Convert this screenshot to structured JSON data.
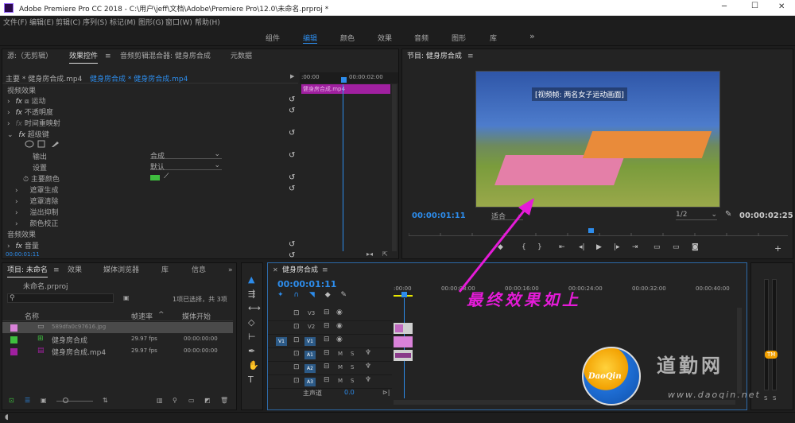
{
  "titlebar": {
    "title": "Adobe Premiere Pro CC 2018 - C:\\用户\\jeff\\文档\\Adobe\\Premiere Pro\\12.0\\未命名.prproj *",
    "min": "─",
    "max": "☐",
    "close": "✕"
  },
  "menu": [
    "文件(F)",
    "编辑(E)",
    "剪辑(C)",
    "序列(S)",
    "标记(M)",
    "图形(G)",
    "窗口(W)",
    "帮助(H)"
  ],
  "workspaces": [
    "组件",
    "编辑",
    "颜色",
    "效果",
    "音频",
    "图形",
    "库"
  ],
  "workspace_more": "»",
  "source_panel": {
    "tabs": [
      "源:（无剪辑）",
      "效果控件",
      "音频剪辑混合器: 健身房合成",
      "元数据"
    ],
    "tab_menu": "≡",
    "master": "主要 * 健身房合成.mp4",
    "clip": "健身房合成 * 健身房合成.mp4",
    "play": "▶",
    "ruler_start": ":00:00",
    "ruler_end": "00:00:02:00",
    "clip_label": "健身房合成.mp4",
    "section_video": "视频效果",
    "section_audio": "音频效果",
    "fx": "fx",
    "effects": [
      "运动",
      "不透明度",
      "时间重映射",
      "超级键"
    ],
    "props": [
      {
        "label": "输出",
        "value": "合成"
      },
      {
        "label": "设置",
        "value": "默认"
      },
      {
        "label": "主要颜色",
        "color": "#3fbf3f"
      }
    ],
    "sub": [
      "遮罩生成",
      "遮罩清除",
      "溢出抑制",
      "颜色校正"
    ],
    "audio_effect": "音量",
    "timecode": "00:00:01:11"
  },
  "program": {
    "title": "节目: 健身房合成",
    "tab_menu": "≡",
    "video_alt": "[视频帧: 两名女子运动画面]",
    "timecode": "00:00:01:11",
    "fit": "适合",
    "res": "1/2",
    "duration": "00:00:02:25"
  },
  "project": {
    "tabs": [
      "项目: 未命名",
      "效果",
      "媒体浏览器",
      "库",
      "信息"
    ],
    "tab_menu": "≡",
    "more": "»",
    "name": "未命名.prproj",
    "selection": "1项已选择，共 3项",
    "columns": [
      "名称",
      "帧速率",
      "媒体开始"
    ],
    "sort": "^",
    "items": [
      {
        "name": "589dfa0c97616.jpg",
        "rate": "",
        "start": "",
        "color": "#d982d9",
        "selected": true
      },
      {
        "name": "健身房合成",
        "rate": "29.97 fps",
        "start": "00:00:00:00",
        "color": "#3fbf3f",
        "selected": false
      },
      {
        "name": "健身房合成.mp4",
        "rate": "29.97 fps",
        "start": "00:00:00:00",
        "color": "#a020a0",
        "selected": false
      }
    ]
  },
  "timeline": {
    "title": "健身房合成",
    "tab_menu": "≡",
    "close": "✕",
    "timecode": "00:00:01:11",
    "ruler": [
      ":00:00",
      "00:00:08:00",
      "00:00:16:00",
      "00:00:24:00",
      "00:00:32:00",
      "00:00:40:00"
    ],
    "tracks": [
      "V3",
      "V2",
      "V1",
      "A1",
      "A2",
      "A3"
    ],
    "source_patch": "V1",
    "master": "主声道",
    "master_value": "0.0",
    "ms": [
      "M",
      "S"
    ],
    "annotation": "最终效果如上"
  },
  "meter": {
    "labels": [
      "S",
      "S"
    ]
  },
  "watermark": {
    "text": "道勤网",
    "url": "www.daoqin.net",
    "logo": "DaoQin",
    "badge": "TM"
  }
}
